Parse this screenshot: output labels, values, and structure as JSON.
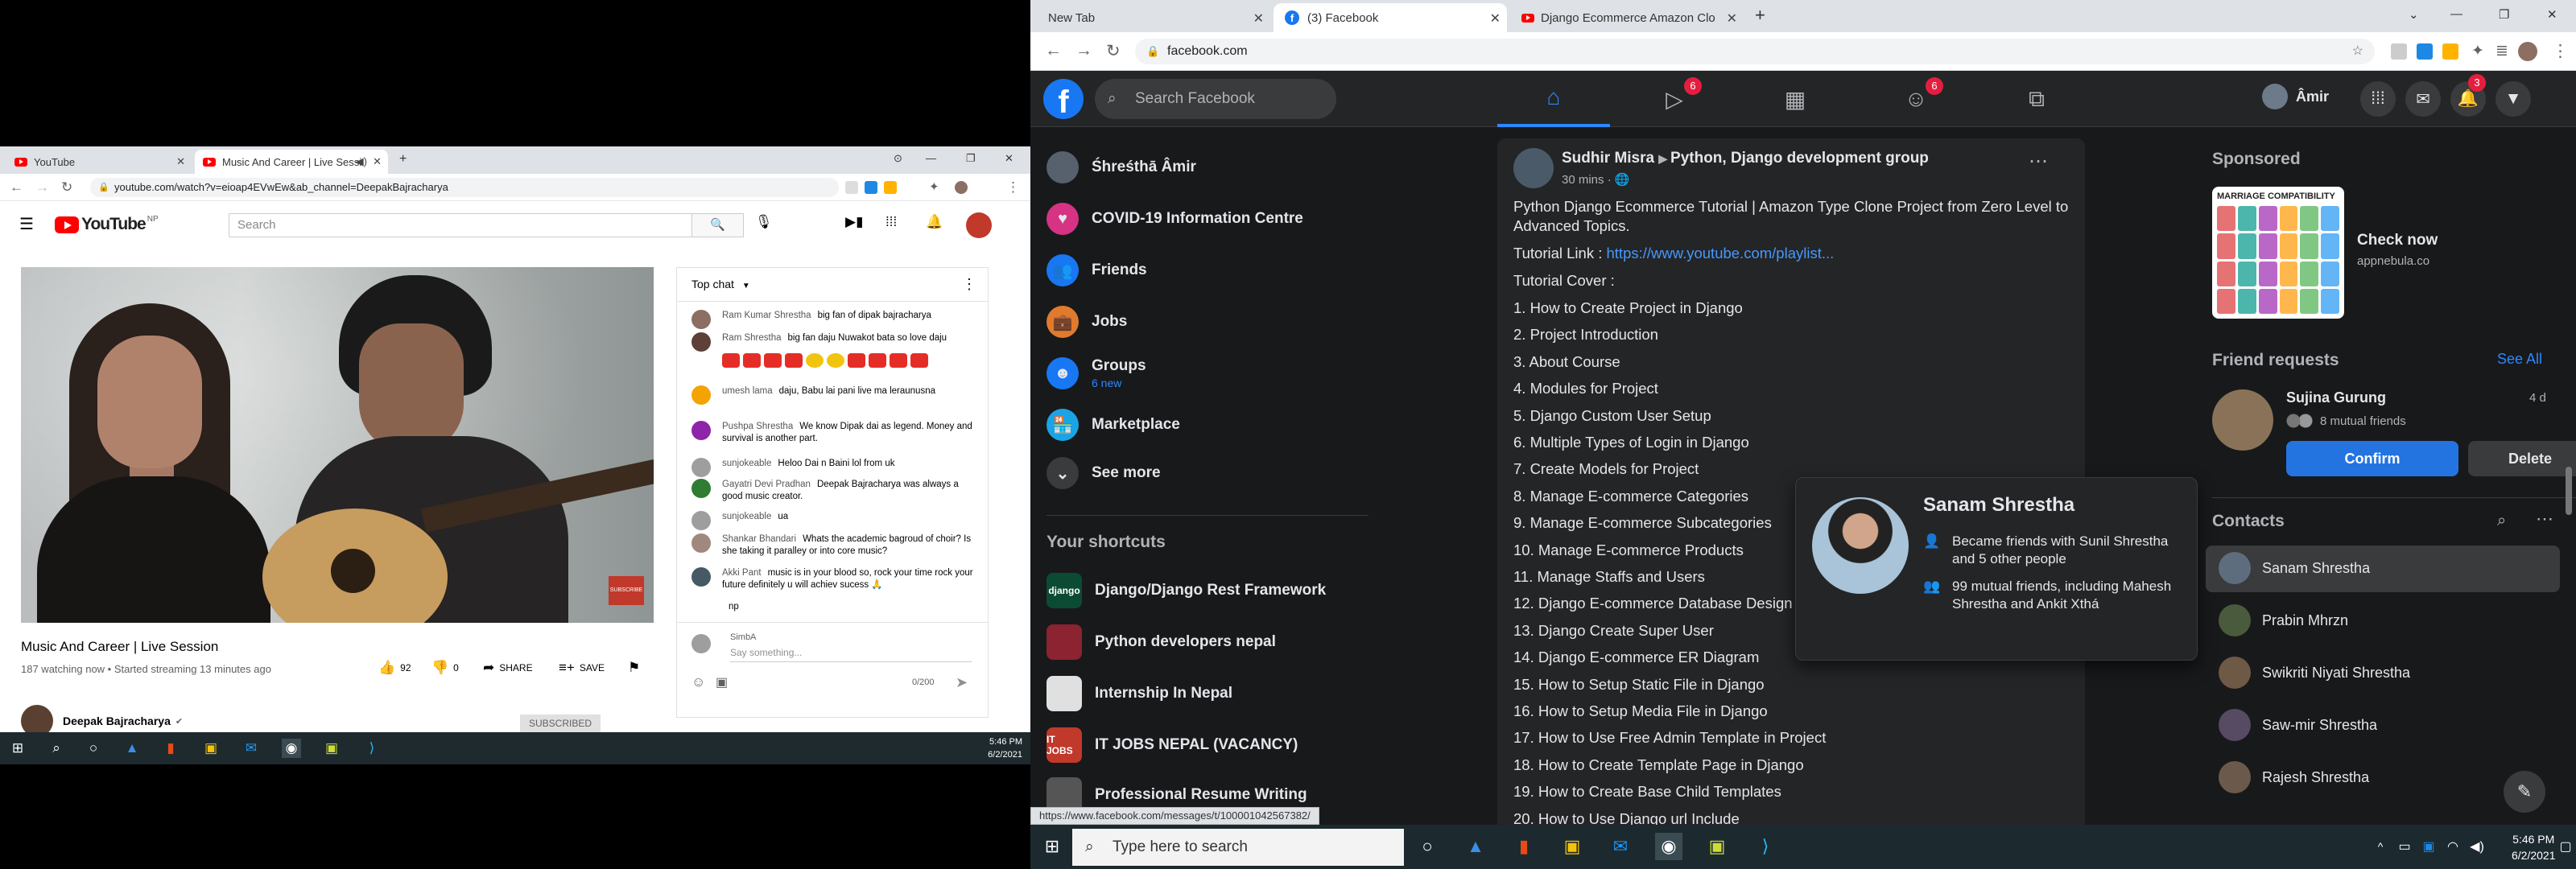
{
  "left_window": {
    "tabs": [
      {
        "label": "YouTube",
        "active": false
      },
      {
        "label": "Music And Career | Live Sessi",
        "active": true
      }
    ],
    "url": "youtube.com/watch?v=eioap4EVwEw&ab_channel=DeepakBajracharya",
    "youtube": {
      "logo": "YouTube",
      "region": "NP",
      "search_placeholder": "Search",
      "video_title": "Music And Career | Live Session",
      "video_meta": "187 watching now • Started streaming 13 minutes ago",
      "likes": "92",
      "dislikes": "0",
      "share_label": "SHARE",
      "save_label": "SAVE",
      "channel_name": "Deepak Bajracharya",
      "subscribe_label": "SUBSCRIBED",
      "video_badge": "SUBSCRIBE"
    },
    "chat": {
      "header": "Top chat",
      "messages": [
        {
          "author": "Ram Kumar Shrestha",
          "text": "big fan of dipak bajracharya",
          "color": "#8d6e63"
        },
        {
          "author": "Ram Shrestha",
          "text": "big fan daju Nuwakot bata so love daju",
          "color": "#5d4037"
        },
        {
          "author": "umesh lama",
          "text": "daju, Babu lai pani live ma leraunusna",
          "color": "#f4a300"
        },
        {
          "author": "Pushpa Shrestha",
          "text": "We know Dipak dai as legend. Money and survival is another part.",
          "color": "#8e24aa"
        },
        {
          "author": "sunjokeable",
          "text": "Heloo Dai n Baini lol from uk",
          "color": "#9e9e9e"
        },
        {
          "author": "Gayatri Devi Pradhan",
          "text": "Deepak Bajracharya was always a good music creator.",
          "color": "#2e7d32"
        },
        {
          "author": "sunjokeable",
          "text": "ua",
          "color": "#9e9e9e"
        },
        {
          "author": "Shankar Bhandari",
          "text": "Whats the academic bagroud of choir? Is she taking it paralley or into core music?",
          "color": "#a1887f"
        },
        {
          "author": "Akki Pant",
          "text": "music is in your blood so, rock your time rock your future definitely u will achiev sucess 🙏",
          "color": "#455a64"
        },
        {
          "author": "",
          "text": "np",
          "color": "#ffffff"
        }
      ],
      "user": "SimbA",
      "input_placeholder": "Say something...",
      "char_count": "0/200"
    },
    "taskbar": {
      "time": "5:46 PM",
      "date": "6/2/2021"
    }
  },
  "right_window": {
    "tabs": [
      {
        "label": "New Tab",
        "active": false
      },
      {
        "label": "(3) Facebook",
        "active": true
      },
      {
        "label": "Django Ecommerce Amazon Clo",
        "active": false
      }
    ],
    "url": "facebook.com",
    "header": {
      "search_placeholder": "Search Facebook",
      "watch_badge": "6",
      "groups_badge": "6",
      "profile_name": "Âmir",
      "notif_badge": "3"
    },
    "sidebar": {
      "items": [
        {
          "label": "Śhreśthā Âmir",
          "icon": "user-avatar",
          "color": "#56616d"
        },
        {
          "label": "COVID-19 Information Centre",
          "icon": "heart-icon",
          "color": "#d63384"
        },
        {
          "label": "Friends",
          "icon": "friends-icon",
          "color": "#1877f2"
        },
        {
          "label": "Jobs",
          "icon": "briefcase-icon",
          "color": "#e07b2e"
        },
        {
          "label": "Groups",
          "sub": "6 new",
          "icon": "groups-icon",
          "color": "#1877f2"
        },
        {
          "label": "Marketplace",
          "icon": "shop-icon",
          "color": "#1aa4e6"
        },
        {
          "label": "See more",
          "icon": "chevron-down-icon",
          "color": "#3a3b3c"
        }
      ],
      "shortcuts_title": "Your shortcuts",
      "shortcuts": [
        {
          "label": "Django/Django Rest Framework",
          "color": "#0c4b33",
          "abbr": "django"
        },
        {
          "label": "Python developers nepal",
          "color": "#8b2331",
          "abbr": ""
        },
        {
          "label": "Internship In Nepal",
          "color": "#e0e0e0",
          "abbr": ""
        },
        {
          "label": "IT JOBS NEPAL (VACANCY)",
          "color": "#c0392b",
          "abbr": "IT JOBS"
        },
        {
          "label": "Professional Resume Writing",
          "color": "#555555",
          "abbr": ""
        }
      ]
    },
    "post": {
      "author": "Sudhir Misra",
      "group": "Python, Django development group",
      "time": "30 mins · 🌐",
      "intro": "Python Django Ecommerce Tutorial | Amazon Type Clone Project from Zero Level to",
      "intro2": "Advanced Topics.",
      "link_label": "Tutorial Link : ",
      "link": "https://www.youtube.com/playlist...",
      "cover_label": "Tutorial Cover :",
      "items": [
        "1. How to Create Project in Django",
        "2. Project Introduction",
        "3. About Course",
        "4. Modules for Project",
        "5. Django Custom User Setup",
        "6. Multiple Types of Login in Django",
        "7. Create Models for Project",
        "8. Manage E-commerce  Categories",
        "9. Manage E-commerce Subcategories",
        "10. Manage E-commerce Products",
        "11. Manage Staffs and Users",
        "12. Django E-commerce Database Design",
        "13. Django Create Super User",
        "14. Django E-commerce ER Diagram",
        "15. How to Setup Static File in Django",
        "16. How to Setup Media File in Django",
        "17. How to Use Free Admin Template in Project",
        "18. How to Create Template Page in Django",
        "19. How to Create Base Child Templates",
        "20. How to Use Django url Include"
      ]
    },
    "hover_card": {
      "name": "Sanam Shrestha",
      "row1": "Became friends with Sunil Shrestha and 5 other people",
      "row2": "99 mutual friends, including Mahesh Shrestha and Ankit Xthá"
    },
    "right_column": {
      "sponsored_title": "Sponsored",
      "ad_image_title": "MARRIAGE COMPATIBILITY",
      "ad_cta": "Check now",
      "ad_domain": "appnebula.co",
      "friend_requests_title": "Friend requests",
      "see_all": "See All",
      "request_name": "Sujina Gurung",
      "request_time": "4 d",
      "request_mutual": "8 mutual friends",
      "confirm_label": "Confirm",
      "delete_label": "Delete",
      "contacts_title": "Contacts",
      "contacts": [
        {
          "name": "Sanam Shrestha",
          "color": "#5d6d7e"
        },
        {
          "name": "Prabin Mhrzn",
          "color": "#4a5a3c"
        },
        {
          "name": "Swikriti Niyati Shrestha",
          "color": "#6e5846"
        },
        {
          "name": "Saw-mir Shrestha",
          "color": "#574a63"
        },
        {
          "name": "Rajesh Shrestha",
          "color": "#6b5a4c"
        }
      ]
    },
    "status_url": "https://www.facebook.com/messages/t/100001042567382/"
  },
  "right_taskbar": {
    "search_placeholder": "Type here to search",
    "time": "5:46 PM",
    "date": "6/2/2021"
  }
}
